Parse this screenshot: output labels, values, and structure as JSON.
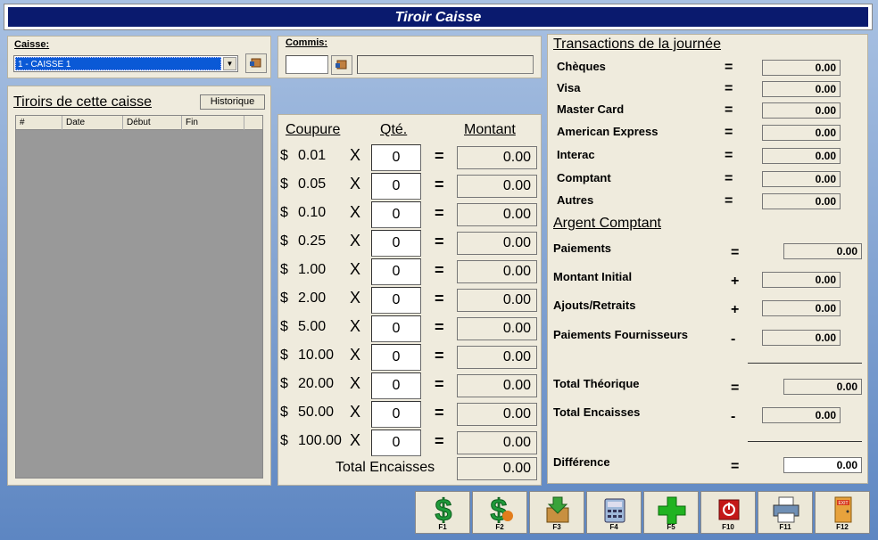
{
  "title": "Tiroir Caisse",
  "caisse": {
    "label": "Caisse:",
    "value": "1 - CAISSE 1"
  },
  "commis": {
    "label": "Commis:",
    "value": ""
  },
  "tiroirs": {
    "title": "Tiroirs de cette caisse",
    "history_btn": "Historique",
    "columns": [
      "#",
      "Date",
      "Début",
      "Fin"
    ]
  },
  "coupures": {
    "col_coupure": "Coupure",
    "col_qty": "Qté.",
    "col_montant": "Montant",
    "rows": [
      {
        "cur": "$",
        "denom": "0.01",
        "x": "X",
        "qty": "0",
        "eq": "=",
        "amount": "0.00"
      },
      {
        "cur": "$",
        "denom": "0.05",
        "x": "X",
        "qty": "0",
        "eq": "=",
        "amount": "0.00"
      },
      {
        "cur": "$",
        "denom": "0.10",
        "x": "X",
        "qty": "0",
        "eq": "=",
        "amount": "0.00"
      },
      {
        "cur": "$",
        "denom": "0.25",
        "x": "X",
        "qty": "0",
        "eq": "=",
        "amount": "0.00"
      },
      {
        "cur": "$",
        "denom": "1.00",
        "x": "X",
        "qty": "0",
        "eq": "=",
        "amount": "0.00"
      },
      {
        "cur": "$",
        "denom": "2.00",
        "x": "X",
        "qty": "0",
        "eq": "=",
        "amount": "0.00"
      },
      {
        "cur": "$",
        "denom": "5.00",
        "x": "X",
        "qty": "0",
        "eq": "=",
        "amount": "0.00"
      },
      {
        "cur": "$",
        "denom": "10.00",
        "x": "X",
        "qty": "0",
        "eq": "=",
        "amount": "0.00"
      },
      {
        "cur": "$",
        "denom": "20.00",
        "x": "X",
        "qty": "0",
        "eq": "=",
        "amount": "0.00"
      },
      {
        "cur": "$",
        "denom": "50.00",
        "x": "X",
        "qty": "0",
        "eq": "=",
        "amount": "0.00"
      },
      {
        "cur": "$",
        "denom": "100.00",
        "x": "X",
        "qty": "0",
        "eq": "=",
        "amount": "0.00"
      }
    ],
    "total_label": "Total Encaisses",
    "total_value": "0.00"
  },
  "transactions": {
    "title": "Transactions de la journée",
    "rows": [
      {
        "label": "Chèques",
        "sym": "=",
        "value": "0.00"
      },
      {
        "label": "Visa",
        "sym": "=",
        "value": "0.00"
      },
      {
        "label": "Master Card",
        "sym": "=",
        "value": "0.00"
      },
      {
        "label": "American Express",
        "sym": "=",
        "value": "0.00"
      },
      {
        "label": "Interac",
        "sym": "=",
        "value": "0.00"
      },
      {
        "label": "Comptant",
        "sym": "=",
        "value": "0.00"
      },
      {
        "label": "Autres",
        "sym": "=",
        "value": "0.00"
      }
    ]
  },
  "argent": {
    "title": "Argent Comptant",
    "rows": [
      {
        "label": "Paiements",
        "sym": "=",
        "value": "0.00"
      },
      {
        "label": "Montant Initial",
        "sym": "+",
        "value": "0.00"
      },
      {
        "label": "Ajouts/Retraits",
        "sym": "+",
        "value": "0.00"
      },
      {
        "label": "Paiements Fournisseurs",
        "sym": "-",
        "value": "0.00"
      },
      {
        "label": "Total Théorique",
        "sym": "=",
        "value": "0.00"
      },
      {
        "label": "Total Encaisses",
        "sym": "-",
        "value": "0.00"
      },
      {
        "label": "Différence",
        "sym": "=",
        "value": "0.00"
      }
    ]
  },
  "fkeys": [
    "F1",
    "F2",
    "F3",
    "F4",
    "F5",
    "F10",
    "F11",
    "F12"
  ],
  "icons": {
    "f1": "dollar-icon",
    "f2": "dollar-refresh-icon",
    "f3": "box-download-icon",
    "f4": "calculator-icon",
    "f5": "plus-icon",
    "f10": "power-icon",
    "f11": "printer-icon",
    "f12": "exit-door-icon",
    "search": "search-hand-icon"
  }
}
